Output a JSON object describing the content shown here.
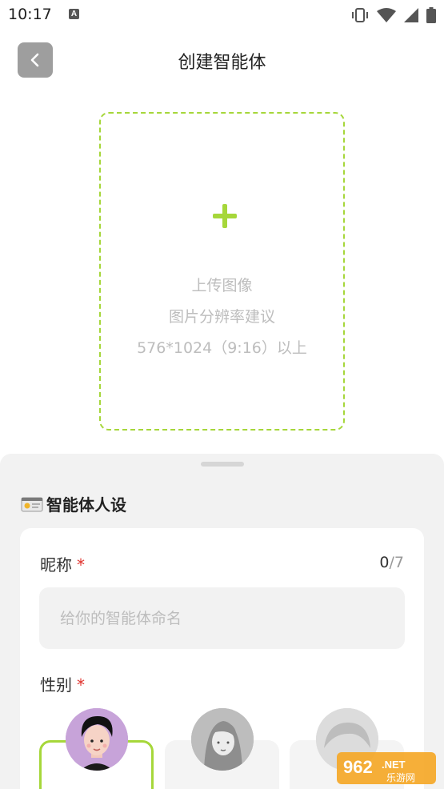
{
  "status_bar": {
    "time": "10:17",
    "notification_letter": "A"
  },
  "header": {
    "title": "创建智能体"
  },
  "upload": {
    "line1": "上传图像",
    "line2": "图片分辨率建议",
    "line3": "576*1024（9:16）以上"
  },
  "persona": {
    "section_title": "智能体人设",
    "nickname_label": "昵称",
    "required_mark": "*",
    "counter_current": "0",
    "counter_max": "/7",
    "nickname_placeholder": "给你的智能体命名",
    "gender_label": "性别"
  },
  "watermark": {
    "number": "962",
    "suffix": ".NET",
    "site": "乐游网"
  },
  "colors": {
    "accent": "#a6d73a",
    "required": "#e0302b"
  }
}
